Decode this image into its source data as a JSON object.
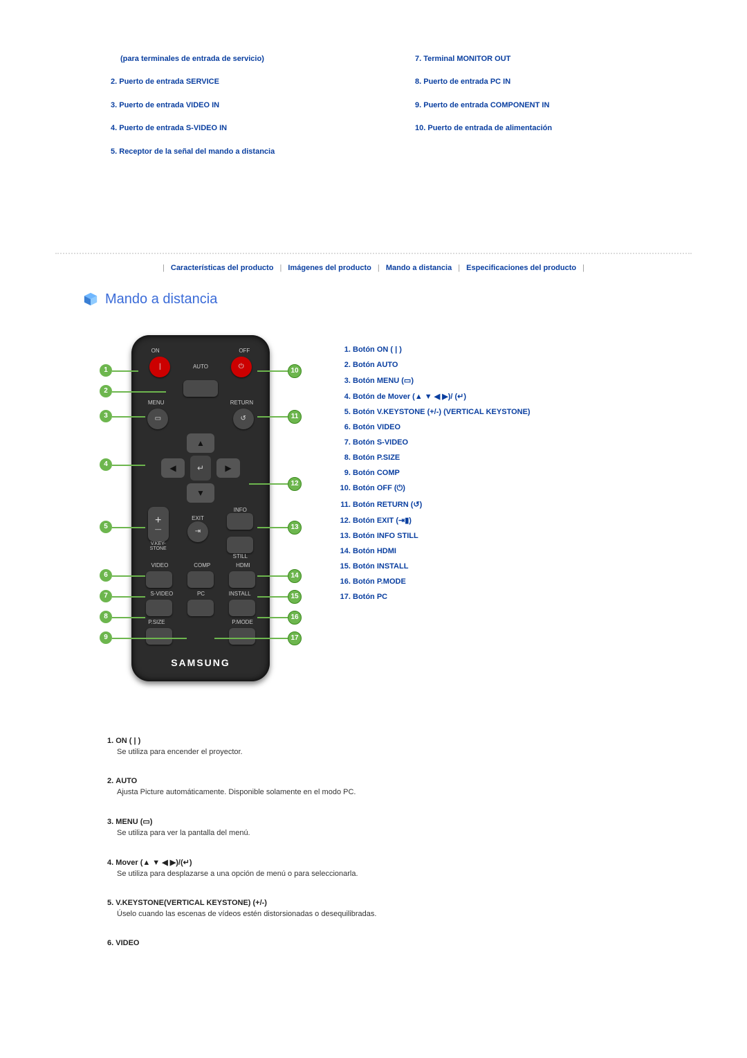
{
  "ports": {
    "left": [
      {
        "num": "",
        "text": "(para terminales de entrada de servicio)",
        "indent": true
      },
      {
        "num": "2.",
        "text": "Puerto de entrada SERVICE"
      },
      {
        "num": "3.",
        "text": "Puerto de entrada VIDEO IN"
      },
      {
        "num": "4.",
        "text": "Puerto de entrada S-VIDEO IN"
      },
      {
        "num": "5.",
        "text": "Receptor de la señal del mando a distancia"
      }
    ],
    "right": [
      {
        "num": "7.",
        "text": "Terminal MONITOR OUT"
      },
      {
        "num": "8.",
        "text": "Puerto de entrada PC IN"
      },
      {
        "num": "9.",
        "text": "Puerto de entrada COMPONENT IN"
      },
      {
        "num": "10.",
        "text": "Puerto de entrada de alimentación"
      }
    ]
  },
  "nav": {
    "items": [
      "Características del producto",
      "Imágenes del producto",
      "Mando a distancia",
      "Especificaciones del producto"
    ]
  },
  "section_title": "Mando a distancia",
  "remote_labels": {
    "on": "ON",
    "off": "OFF",
    "auto": "AUTO",
    "menu": "MENU",
    "return": "RETURN",
    "vkeystone": "V.KEY-\nSTONE",
    "exit": "EXIT",
    "info": "INFO",
    "still": "STILL",
    "video": "VIDEO",
    "comp": "COMP",
    "hdmi": "HDMI",
    "svideo": "S-VIDEO",
    "pc": "PC",
    "install": "INSTALL",
    "psize": "P.SIZE",
    "pmode": "P.MODE",
    "brand": "SAMSUNG"
  },
  "legend_items": [
    {
      "text": "Botón ON ( | )"
    },
    {
      "text": "Botón AUTO"
    },
    {
      "text": "Botón MENU (▭)"
    },
    {
      "text": "Botón de Mover (▲ ▼ ◀ ▶)/ (↵)"
    },
    {
      "text": "Botón V.KEYSTONE (+/-) (VERTICAL KEYSTONE)"
    },
    {
      "text": "Botón VIDEO"
    },
    {
      "text": "Botón S-VIDEO"
    },
    {
      "text": "Botón P.SIZE"
    },
    {
      "text": "Botón COMP"
    },
    {
      "text": "Botón OFF (⏻)"
    },
    {
      "text": "Botón RETURN (↺)"
    },
    {
      "text": "Botón EXIT (⇥▮)"
    },
    {
      "text": "Botón INFO STILL"
    },
    {
      "text": "Botón HDMI"
    },
    {
      "text": "Botón INSTALL"
    },
    {
      "text": "Botón P.MODE"
    },
    {
      "text": "Botón PC"
    }
  ],
  "details": [
    {
      "num": "1.",
      "title": "ON ( | )",
      "desc": "Se utiliza para encender el proyector."
    },
    {
      "num": "2.",
      "title": "AUTO",
      "desc": "Ajusta Picture automáticamente. Disponible solamente en el modo PC."
    },
    {
      "num": "3.",
      "title": "MENU (▭)",
      "desc": "Se utiliza para ver la pantalla del menú."
    },
    {
      "num": "4.",
      "title": "Mover (▲ ▼ ◀ ▶)/(↵)",
      "desc": "Se utiliza para desplazarse a una opción de menú o para seleccionarla."
    },
    {
      "num": "5.",
      "title": "V.KEYSTONE(VERTICAL KEYSTONE) (+/-)",
      "desc": "Úselo cuando las escenas de vídeos estén distorsionadas o desequilibradas."
    },
    {
      "num": "6.",
      "title": "VIDEO",
      "desc": ""
    }
  ]
}
